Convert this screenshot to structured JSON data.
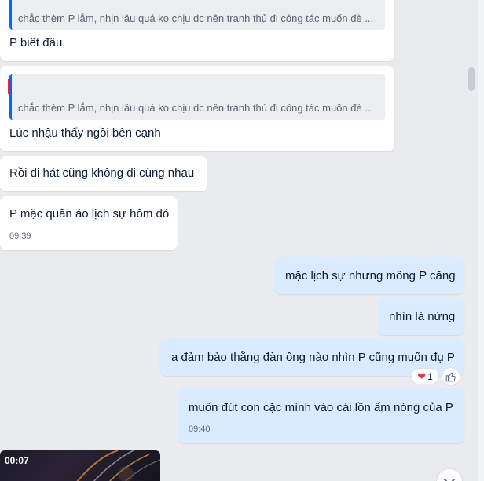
{
  "messages": {
    "m1_quote": "chắc thèm P lắm, nhịn lâu quá ko chịu dc nên tranh thủ đi công tác muốn đè ...",
    "m1_text": "P biết đâu",
    "m2_quote": "chắc thèm P lắm, nhịn lâu quá ko chịu dc nên tranh thủ đi công tác muốn đè ...",
    "m2_text": "Lúc nhậu thấy ngồi bên cạnh",
    "m3_text": "Rồi đi hát cũng không đi cùng nhau",
    "m4_text": "P mặc quần áo lịch sự hôm đó",
    "m4_time": "09:39",
    "m5_text": "mặc lịch sự nhưng mông P căng",
    "m6_text": "nhìn là nứng",
    "m7_text": "a đảm bảo thằng đàn ông nào nhìn P cũng muốn đụ P",
    "m7_reaction_count": "1",
    "m8_text": "muốn đút con cặc mình vào cái lồn ấm nóng của P",
    "m8_time": "09:40"
  },
  "video": {
    "duration": "00:07"
  },
  "icons": {
    "reaction": "heart-icon",
    "like": "thumbs-up-icon",
    "scroll": "chevron-down-icon"
  },
  "colors": {
    "background": "#e9ebed",
    "incoming_bubble": "#ffffff",
    "outgoing_bubble": "#dbebff",
    "quote_bar": "#0068ff",
    "redaction": "#ff1f1f"
  }
}
